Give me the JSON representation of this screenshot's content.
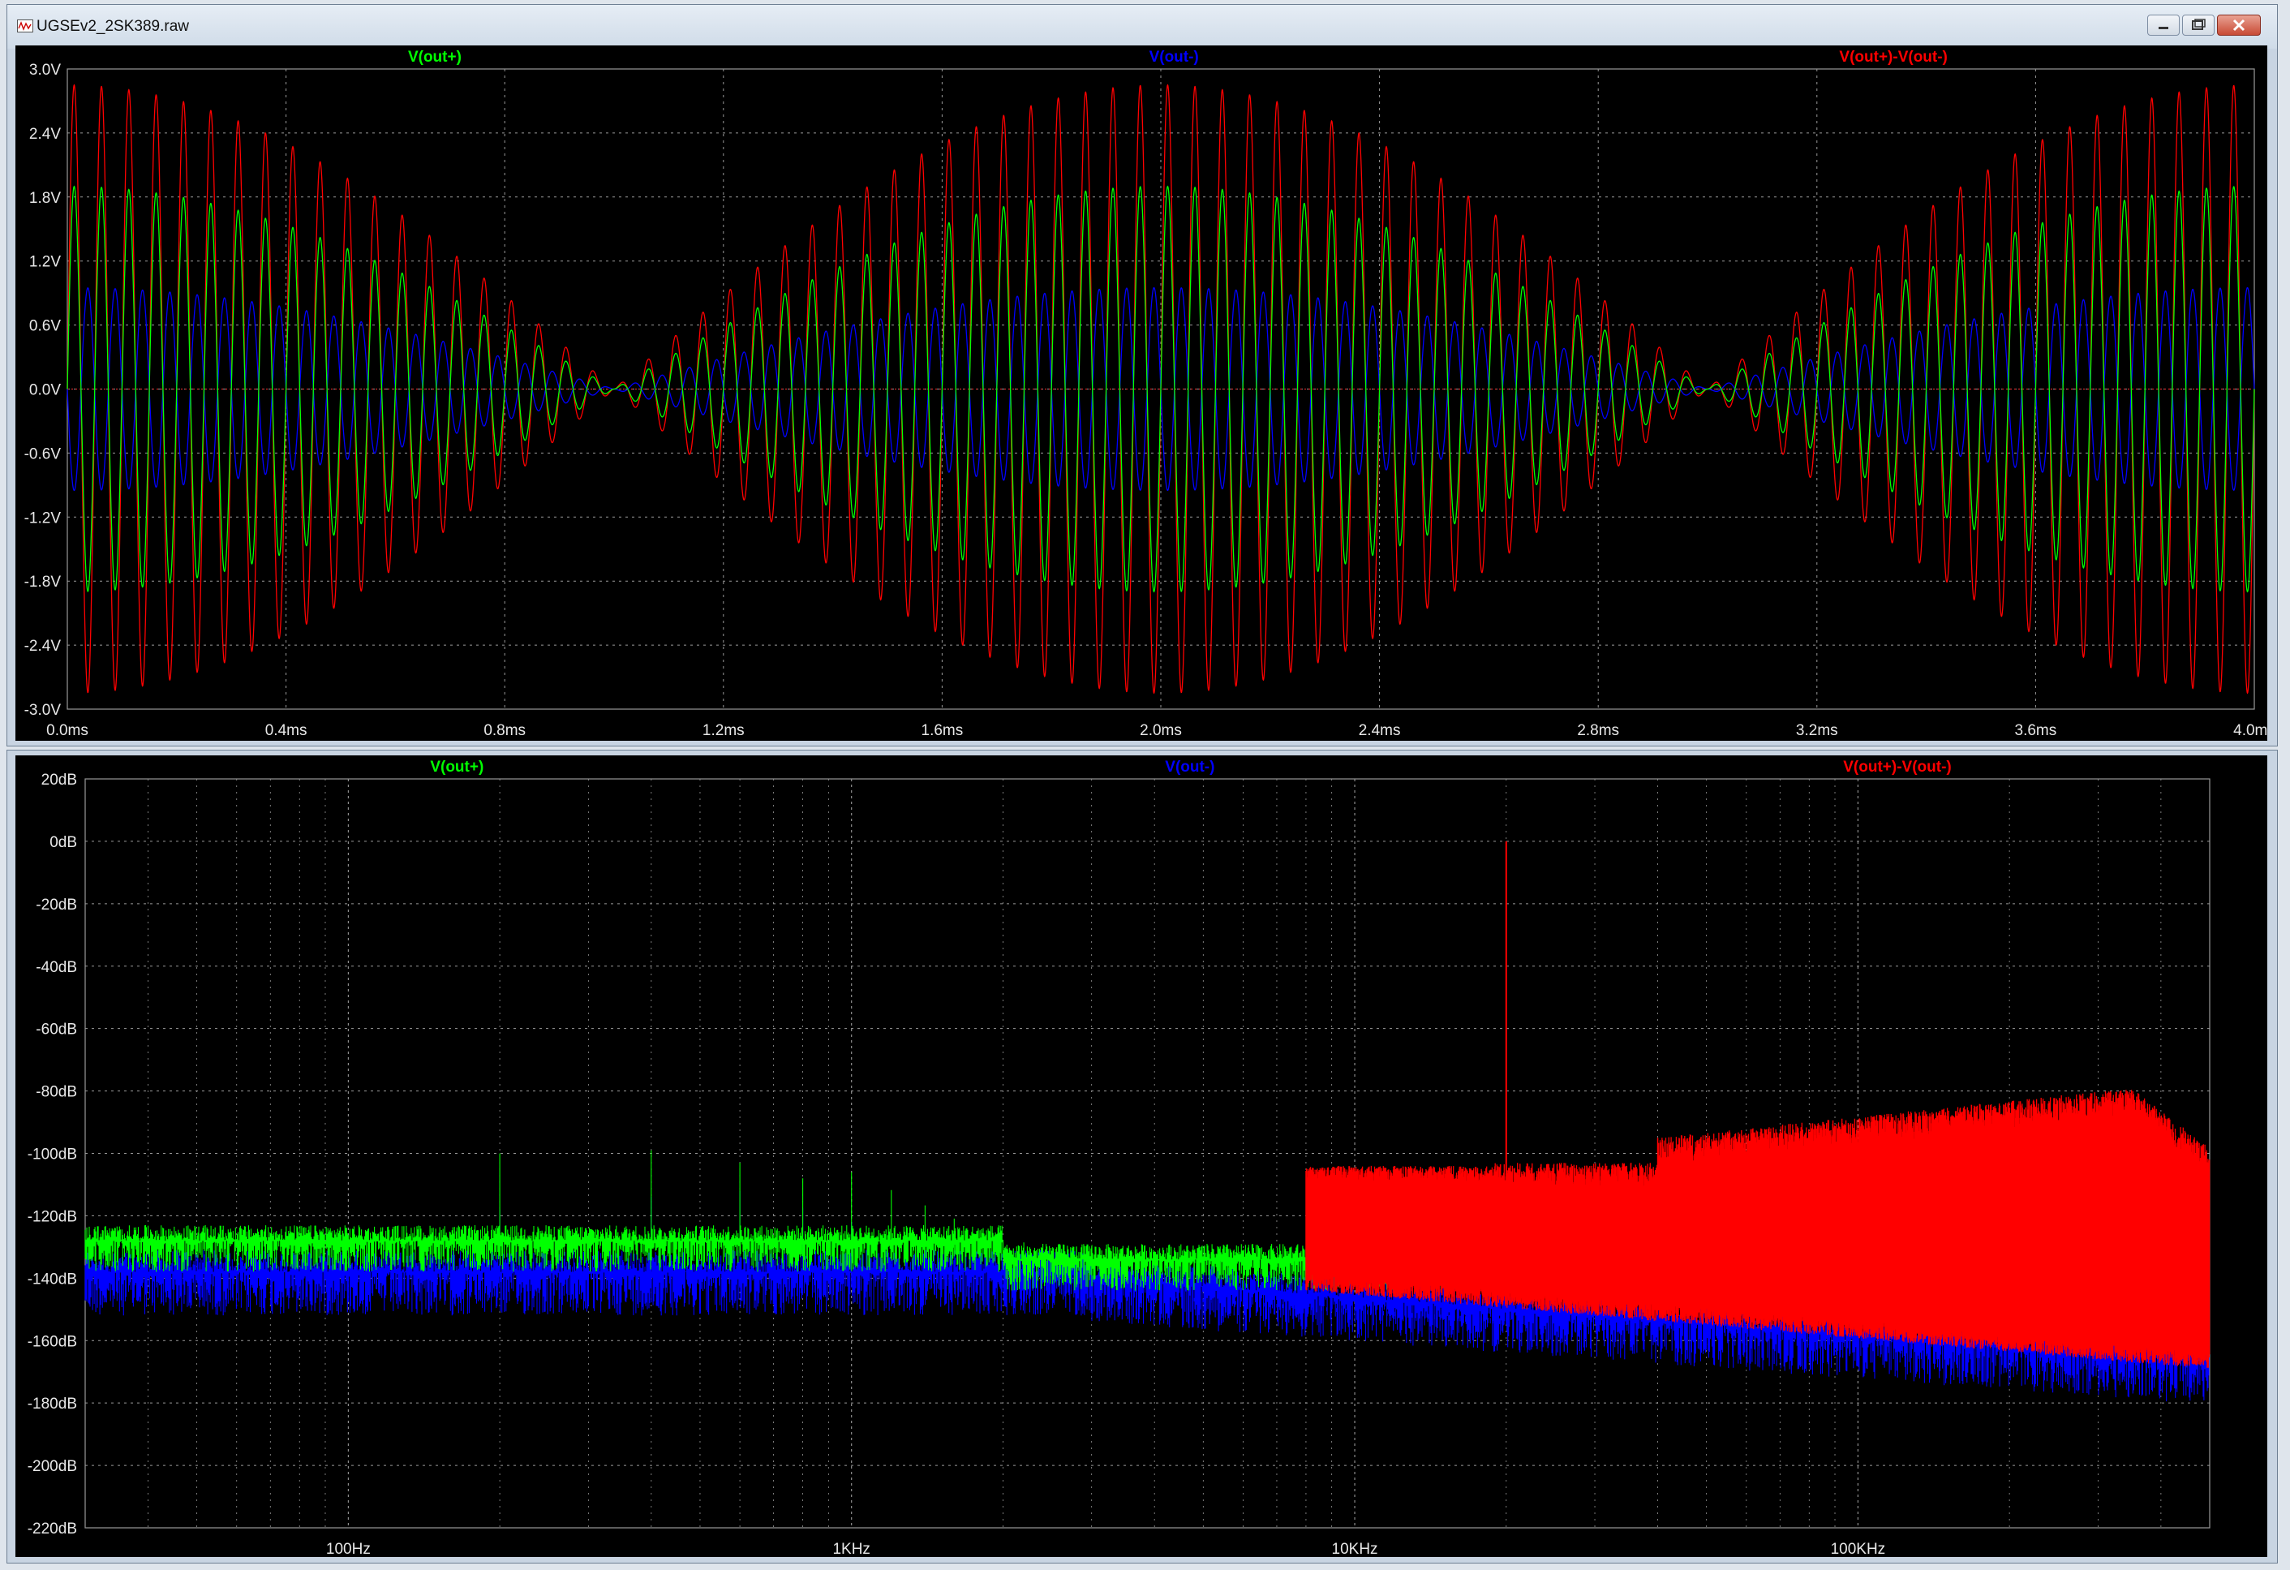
{
  "window": {
    "title": "UGSEv2_2SK389.raw"
  },
  "colors": {
    "green": "#00ff00",
    "blue": "#0000ff",
    "red": "#ff0000",
    "grid": "#9a9a9a",
    "axis_text": "#e8e8e8",
    "background": "#000000"
  },
  "chart_data": [
    {
      "type": "line",
      "traces": [
        "V(out+)",
        "V(out-)",
        "V(out+)-V(out-)"
      ],
      "trace_colors": [
        "#00ff00",
        "#0000ff",
        "#ff0000"
      ],
      "xlabel": "",
      "ylabel": "",
      "xlim": [
        0,
        4
      ],
      "ylim": [
        -3,
        3
      ],
      "x_ticks": [
        "0.0ms",
        "0.4ms",
        "0.8ms",
        "1.2ms",
        "1.6ms",
        "2.0ms",
        "2.4ms",
        "2.8ms",
        "3.2ms",
        "3.6ms",
        "4.0ms"
      ],
      "y_ticks": [
        "3.0V",
        "2.4V",
        "1.8V",
        "1.2V",
        "0.6V",
        "0.0V",
        "-0.6V",
        "-1.2V",
        "-1.8V",
        "-2.4V",
        "-3.0V"
      ],
      "grid": true,
      "series": [
        {
          "name": "V(out+)",
          "carrier_khz": 20,
          "envelope_hz": 500,
          "peak_v": 1.9
        },
        {
          "name": "V(out-)",
          "carrier_khz": 20,
          "envelope_hz": 500,
          "peak_v": 0.95
        },
        {
          "name": "V(out+)-V(out-)",
          "carrier_khz": 20,
          "envelope_hz": 500,
          "peak_v": 2.85
        }
      ]
    },
    {
      "type": "line",
      "traces": [
        "V(out+)",
        "V(out-)",
        "V(out+)-V(out-)"
      ],
      "trace_colors": [
        "#00ff00",
        "#0000ff",
        "#ff0000"
      ],
      "xlabel": "",
      "ylabel": "",
      "x_scale": "log",
      "xlim": [
        30,
        500000
      ],
      "ylim": [
        -220,
        20
      ],
      "x_ticks": [
        {
          "label": "100Hz",
          "value": 100
        },
        {
          "label": "1KHz",
          "value": 1000
        },
        {
          "label": "10KHz",
          "value": 10000
        },
        {
          "label": "100KHz",
          "value": 100000
        }
      ],
      "y_ticks": [
        "20dB",
        "0dB",
        "-20dB",
        "-40dB",
        "-60dB",
        "-80dB",
        "-100dB",
        "-120dB",
        "-140dB",
        "-160dB",
        "-180dB",
        "-200dB",
        "-220dB"
      ],
      "grid": true,
      "series": [
        {
          "name": "V(out+)-V(out-)",
          "points": [
            [
              200,
              -97
            ],
            [
              400,
              -98
            ],
            [
              600,
              -100
            ],
            [
              800,
              -103
            ],
            [
              1000,
              -104
            ],
            [
              1200,
              -105
            ],
            [
              1400,
              -106
            ],
            [
              19000,
              -104
            ],
            [
              20000,
              0
            ],
            [
              40000,
              -95
            ],
            [
              350000,
              -79
            ],
            [
              500000,
              -98
            ]
          ]
        },
        {
          "name": "V(out+)",
          "points": [
            [
              100,
              -128
            ],
            [
              200,
              -100
            ],
            [
              400,
              -99
            ],
            [
              600,
              -103
            ],
            [
              800,
              -108
            ],
            [
              1000,
              -106
            ],
            [
              2000,
              -128
            ],
            [
              5000,
              -133
            ],
            [
              10000,
              -135
            ]
          ]
        },
        {
          "name": "V(out-)",
          "points": [
            [
              100,
              -140
            ],
            [
              200,
              -118
            ],
            [
              400,
              -114
            ],
            [
              600,
              -112
            ],
            [
              1000,
              -122
            ],
            [
              2000,
              -142
            ],
            [
              10000,
              -150
            ],
            [
              100000,
              -160
            ],
            [
              500000,
              -175
            ]
          ]
        }
      ]
    }
  ]
}
